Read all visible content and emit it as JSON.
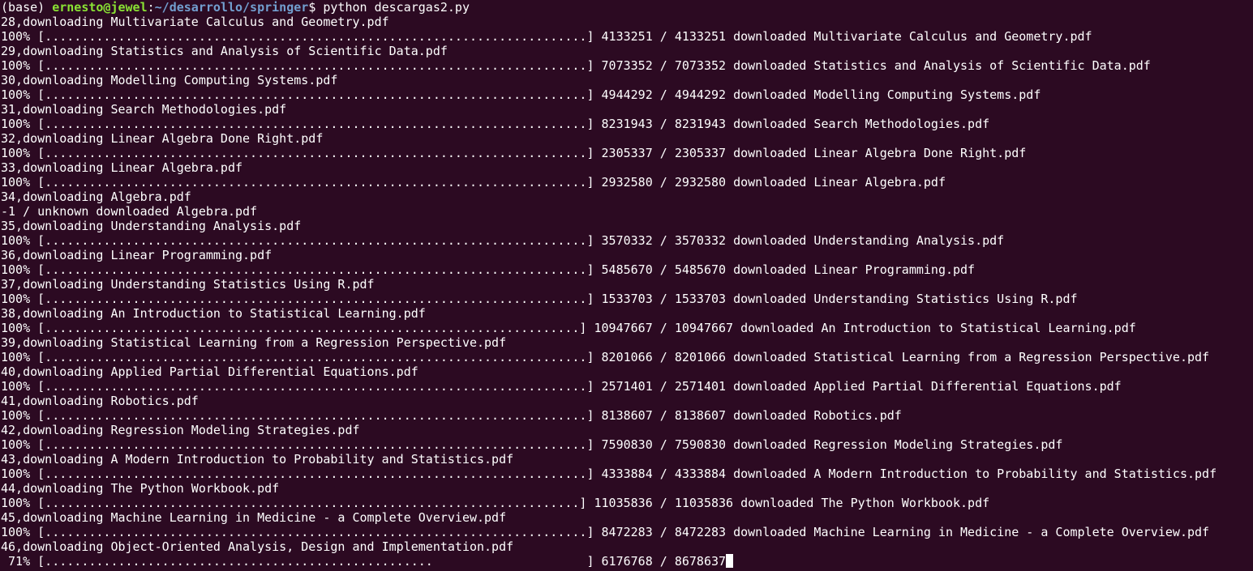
{
  "colors": {
    "background": "#2c0a22",
    "foreground": "#ffffff",
    "prompt_user": "#8ae234",
    "prompt_path": "#729fcf"
  },
  "prompt": {
    "env": "(base) ",
    "user_host": "ernesto@jewel",
    "sep": ":",
    "path": "~/desarrollo/springer",
    "symbol": "$ ",
    "command": "python descargas2.py"
  },
  "lines": [
    "28,downloading Multivariate Calculus and Geometry.pdf",
    "100% [..........................................................................] 4133251 / 4133251 downloaded Multivariate Calculus and Geometry.pdf",
    "29,downloading Statistics and Analysis of Scientific Data.pdf",
    "100% [..........................................................................] 7073352 / 7073352 downloaded Statistics and Analysis of Scientific Data.pdf",
    "30,downloading Modelling Computing Systems.pdf",
    "100% [..........................................................................] 4944292 / 4944292 downloaded Modelling Computing Systems.pdf",
    "31,downloading Search Methodologies.pdf",
    "100% [..........................................................................] 8231943 / 8231943 downloaded Search Methodologies.pdf",
    "32,downloading Linear Algebra Done Right.pdf",
    "100% [..........................................................................] 2305337 / 2305337 downloaded Linear Algebra Done Right.pdf",
    "33,downloading Linear Algebra.pdf",
    "100% [..........................................................................] 2932580 / 2932580 downloaded Linear Algebra.pdf",
    "34,downloading Algebra.pdf",
    "-1 / unknown downloaded Algebra.pdf",
    "35,downloading Understanding Analysis.pdf",
    "100% [..........................................................................] 3570332 / 3570332 downloaded Understanding Analysis.pdf",
    "36,downloading Linear Programming.pdf",
    "100% [..........................................................................] 5485670 / 5485670 downloaded Linear Programming.pdf",
    "37,downloading Understanding Statistics Using R.pdf",
    "100% [..........................................................................] 1533703 / 1533703 downloaded Understanding Statistics Using R.pdf",
    "38,downloading An Introduction to Statistical Learning.pdf",
    "100% [.........................................................................] 10947667 / 10947667 downloaded An Introduction to Statistical Learning.pdf",
    "39,downloading Statistical Learning from a Regression Perspective.pdf",
    "100% [..........................................................................] 8201066 / 8201066 downloaded Statistical Learning from a Regression Perspective.pdf",
    "40,downloading Applied Partial Differential Equations.pdf",
    "100% [..........................................................................] 2571401 / 2571401 downloaded Applied Partial Differential Equations.pdf",
    "41,downloading Robotics.pdf",
    "100% [..........................................................................] 8138607 / 8138607 downloaded Robotics.pdf",
    "42,downloading Regression Modeling Strategies.pdf",
    "100% [..........................................................................] 7590830 / 7590830 downloaded Regression Modeling Strategies.pdf",
    "43,downloading A Modern Introduction to Probability and Statistics.pdf",
    "100% [..........................................................................] 4333884 / 4333884 downloaded A Modern Introduction to Probability and Statistics.pdf",
    "44,downloading The Python Workbook.pdf",
    "100% [.........................................................................] 11035836 / 11035836 downloaded The Python Workbook.pdf",
    "45,downloading Machine Learning in Medicine - a Complete Overview.pdf",
    "100% [..........................................................................] 8472283 / 8472283 downloaded Machine Learning in Medicine - a Complete Overview.pdf",
    "46,downloading Object-Oriented Analysis, Design and Implementation.pdf",
    " 71% [.....................................................                     ] 6176768 / 8678637"
  ],
  "current_download": {
    "progress": 0.71
  }
}
